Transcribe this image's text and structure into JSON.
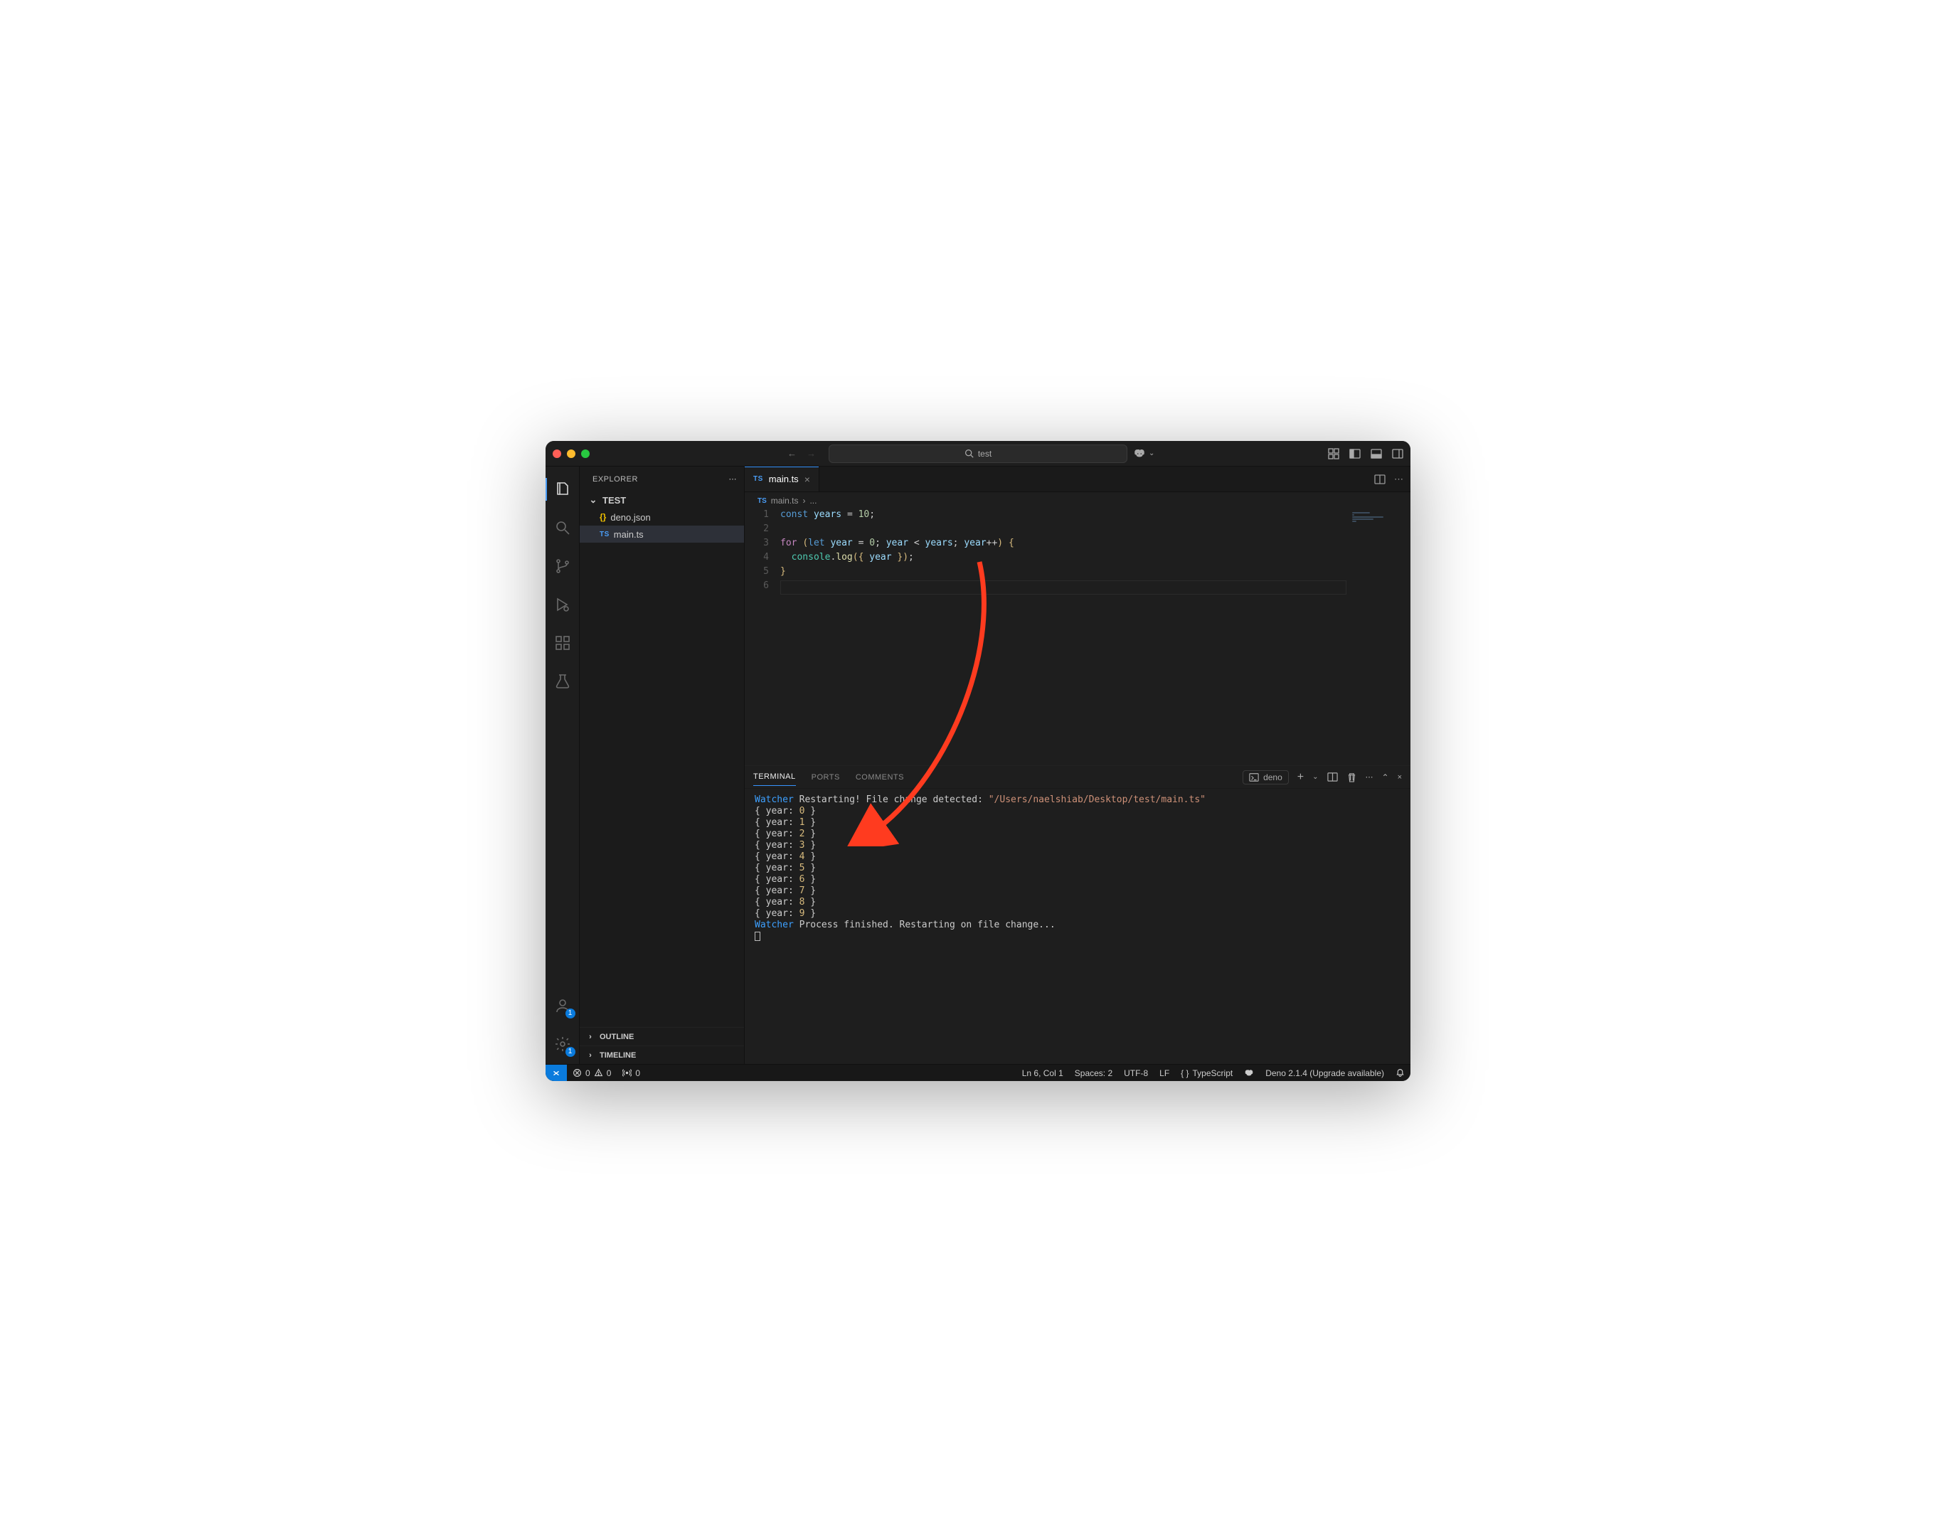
{
  "titlebar": {
    "search_text": "test"
  },
  "sidebar": {
    "title": "EXPLORER",
    "folder_name": "TEST",
    "files": [
      {
        "icon": "json",
        "name": "deno.json"
      },
      {
        "icon": "ts",
        "name": "main.ts"
      }
    ],
    "outline_label": "OUTLINE",
    "timeline_label": "TIMELINE",
    "accounts_badge": "1",
    "settings_badge": "1"
  },
  "tabs": {
    "active_tab_label": "main.ts",
    "active_tab_icon_label": "TS"
  },
  "breadcrumbs": {
    "icon_label": "TS",
    "file": "main.ts",
    "sep": "›",
    "tail": "..."
  },
  "editor": {
    "lines": [
      {
        "n": "1",
        "html": "<span class='tok-kw2'>const</span> <span class='tok-var'>years</span> <span class='tok-punc'>=</span> <span class='tok-num'>10</span><span class='tok-punc'>;</span>"
      },
      {
        "n": "2",
        "html": ""
      },
      {
        "n": "3",
        "html": "<span class='tok-kw'>for</span> <span class='tok-brace'>(</span><span class='tok-kw2'>let</span> <span class='tok-var'>year</span> <span class='tok-punc'>=</span> <span class='tok-num'>0</span><span class='tok-punc'>;</span> <span class='tok-var'>year</span> <span class='tok-punc'>&lt;</span> <span class='tok-var'>years</span><span class='tok-punc'>;</span> <span class='tok-var'>year</span><span class='tok-punc'>++</span><span class='tok-brace'>)</span> <span class='tok-brace'>{</span>"
      },
      {
        "n": "4",
        "html": "  <span class='tok-obj'>console</span><span class='tok-punc'>.</span><span class='tok-fn'>log</span><span class='tok-brace'>(</span><span class='tok-brace'>{</span> <span class='tok-var'>year</span> <span class='tok-brace'>}</span><span class='tok-brace'>)</span><span class='tok-punc'>;</span>"
      },
      {
        "n": "5",
        "html": "<span class='tok-brace'>}</span>"
      },
      {
        "n": "6",
        "html": ""
      }
    ]
  },
  "panel": {
    "tabs": {
      "terminal": "TERMINAL",
      "ports": "PORTS",
      "comments": "COMMENTS"
    },
    "deno_label": "deno"
  },
  "terminal": {
    "watcher_restart_prefix": "Watcher",
    "watcher_restart_text": " Restarting! File change detected: ",
    "watcher_restart_path": "\"/Users/naelshiab/Desktop/test/main.ts\"",
    "year_key": "year:",
    "values": [
      "0",
      "1",
      "2",
      "3",
      "4",
      "5",
      "6",
      "7",
      "8",
      "9"
    ],
    "watcher_done_prefix": "Watcher",
    "watcher_done_text": " Process finished. Restarting on file change..."
  },
  "status": {
    "errors": "0",
    "warnings": "0",
    "ports": "0",
    "cursor": "Ln 6, Col 1",
    "spaces": "Spaces: 2",
    "encoding": "UTF-8",
    "eol": "LF",
    "lang": "TypeScript",
    "deno": "Deno 2.1.4 (Upgrade available)"
  }
}
